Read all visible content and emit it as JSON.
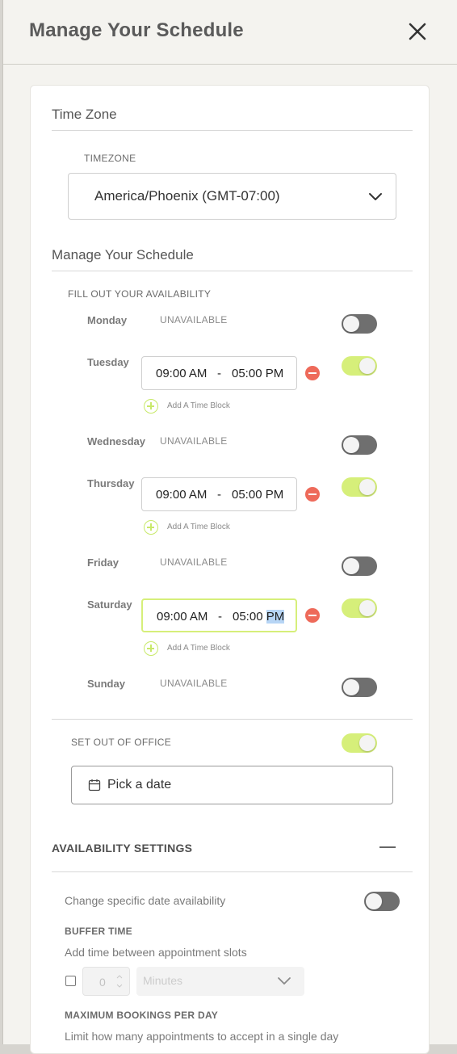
{
  "header": {
    "title": "Manage Your Schedule"
  },
  "timezone_section": {
    "title": "Time Zone",
    "field_label": "TIMEZONE",
    "selected": "America/Phoenix (GMT-07:00)"
  },
  "schedule_section": {
    "title": "Manage Your Schedule",
    "subtitle": "FILL OUT YOUR AVAILABILITY",
    "unavailable_text": "UNAVAILABLE",
    "add_block_label": "Add A Time Block",
    "days": [
      {
        "name": "Monday",
        "available": false
      },
      {
        "name": "Tuesday",
        "available": true,
        "start": "09:00 AM",
        "end_time": "05:00",
        "end_period": "PM"
      },
      {
        "name": "Wednesday",
        "available": false
      },
      {
        "name": "Thursday",
        "available": true,
        "start": "09:00 AM",
        "end_time": "05:00",
        "end_period": "PM"
      },
      {
        "name": "Friday",
        "available": false
      },
      {
        "name": "Saturday",
        "available": true,
        "start": "09:00 AM",
        "end_time": "05:00",
        "end_period": "PM"
      },
      {
        "name": "Sunday",
        "available": false
      }
    ],
    "separator": "-"
  },
  "out_of_office": {
    "label": "SET OUT OF OFFICE",
    "enabled": true,
    "date_placeholder": "Pick a date"
  },
  "availability_settings": {
    "title": "AVAILABILITY SETTINGS",
    "change_specific": {
      "label": "Change specific date availability",
      "enabled": false
    },
    "buffer": {
      "title": "BUFFER TIME",
      "description": "Add time between appointment slots",
      "value": "0",
      "unit": "Minutes"
    },
    "max_bookings": {
      "title": "MAXIMUM BOOKINGS PER DAY",
      "description": "Limit how many appointments to accept in a single day"
    }
  },
  "colors": {
    "toggle_on": "#d6ef7a",
    "toggle_off": "#6f6f6f",
    "remove": "#ee6a5a",
    "add": "#c8e96a"
  }
}
